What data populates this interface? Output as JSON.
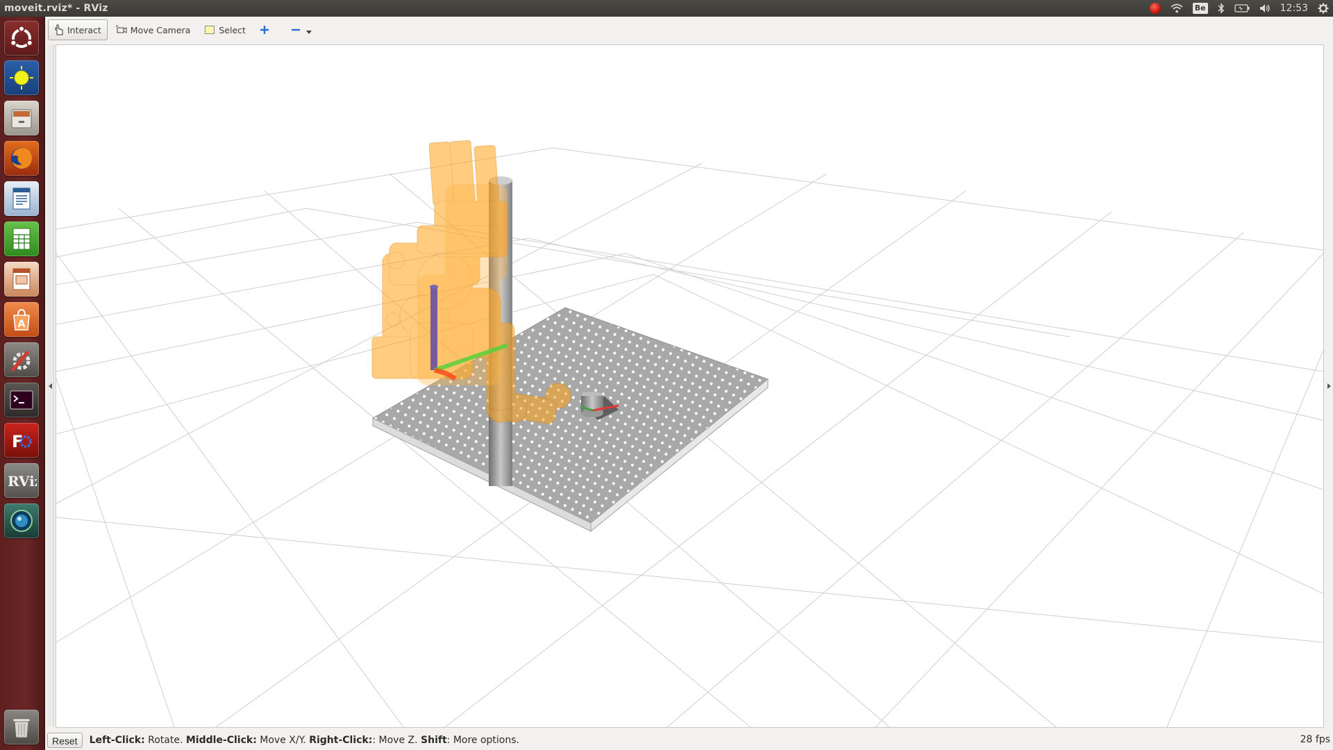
{
  "window": {
    "title": "moveit.rviz* - RViz"
  },
  "panel": {
    "clock": "12:53",
    "keyboard_layout": "Be"
  },
  "launcher": {
    "items": [
      {
        "name": "dash-home",
        "icon": "ubuntu-logo-icon"
      },
      {
        "name": "app-sun",
        "icon": "sun-icon"
      },
      {
        "name": "files",
        "icon": "file-cabinet-icon"
      },
      {
        "name": "firefox",
        "icon": "firefox-icon"
      },
      {
        "name": "writer",
        "icon": "document-icon"
      },
      {
        "name": "calc",
        "icon": "spreadsheet-icon"
      },
      {
        "name": "impress",
        "icon": "presentation-icon"
      },
      {
        "name": "software-center",
        "icon": "shopping-bag-icon"
      },
      {
        "name": "system-settings",
        "icon": "wrench-gear-icon"
      },
      {
        "name": "terminal",
        "icon": "terminal-icon"
      },
      {
        "name": "fetch-gear",
        "icon": "gear-icon"
      },
      {
        "name": "rviz",
        "icon": "rviz-icon"
      },
      {
        "name": "gazebo",
        "icon": "globe-icon"
      },
      {
        "name": "trash",
        "icon": "trash-icon"
      }
    ]
  },
  "toolbar": {
    "interact_label": "Interact",
    "move_camera_label": "Move Camera",
    "select_label": "Select"
  },
  "status": {
    "reset_label": "Reset",
    "hint_parts": [
      {
        "bold": "Left-Click:",
        "text": " Rotate. "
      },
      {
        "bold": "Middle-Click:",
        "text": " Move X/Y. "
      },
      {
        "bold": "Right-Click:",
        "text": ": Move Z. "
      },
      {
        "bold": "Shift",
        "text": ": More options."
      }
    ],
    "fps": "28 fps"
  },
  "colors": {
    "robot": "#ffa31a",
    "table": "#bdbdbd",
    "launcher_bg": "#6b2626",
    "panel_bg": "#3c3b37"
  }
}
